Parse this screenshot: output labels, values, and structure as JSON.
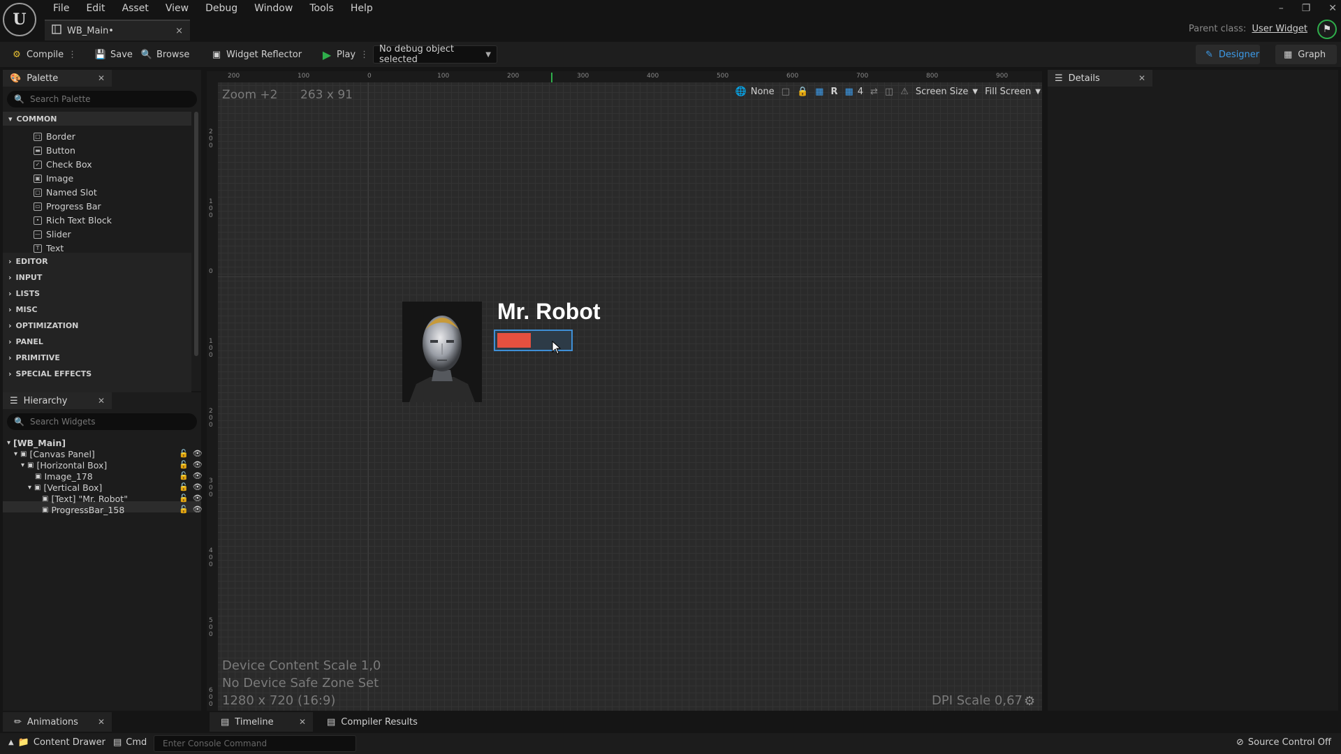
{
  "app": {
    "logo": "U"
  },
  "menu": [
    "File",
    "Edit",
    "Asset",
    "View",
    "Debug",
    "Window",
    "Tools",
    "Help"
  ],
  "doc_tab": {
    "label": "WB_Main•",
    "close": "×"
  },
  "window_controls": [
    "–",
    "❐",
    "✕"
  ],
  "parent_class": {
    "label": "Parent class:",
    "value": "User Widget"
  },
  "toolbar": {
    "compile": "Compile",
    "save": "Save",
    "browse": "Browse",
    "widget_reflector": "Widget Reflector",
    "play": "Play",
    "debug_object": "No debug object selected",
    "designer": "Designer",
    "graph": "Graph"
  },
  "palette": {
    "title": "Palette",
    "search_placeholder": "Search Palette",
    "common_label": "COMMON",
    "common_items": [
      "Border",
      "Button",
      "Check Box",
      "Image",
      "Named Slot",
      "Progress Bar",
      "Rich Text Block",
      "Slider",
      "Text"
    ],
    "categories": [
      "EDITOR",
      "INPUT",
      "LISTS",
      "MISC",
      "OPTIMIZATION",
      "PANEL",
      "PRIMITIVE",
      "SPECIAL EFFECTS"
    ]
  },
  "hierarchy": {
    "title": "Hierarchy",
    "search_placeholder": "Search Widgets",
    "items": [
      "[WB_Main]",
      "[Canvas Panel]",
      "[Horizontal Box]",
      "Image_178",
      "[Vertical Box]",
      "[Text] \"Mr. Robot\"",
      "ProgressBar_158"
    ]
  },
  "details": {
    "title": "Details"
  },
  "canvas": {
    "zoom": "Zoom +2",
    "size": "263 x 91",
    "ruler_top": [
      "200",
      "100",
      "0",
      "100",
      "200",
      "300",
      "400",
      "500",
      "600",
      "700",
      "800",
      "900"
    ],
    "ruler_left": [
      "2\n0\n0",
      "1\n0\n0",
      "0",
      "1\n0\n0",
      "2\n0\n0",
      "3\n0\n0",
      "4\n0\n0",
      "5\n0\n0",
      "6\n0\n0"
    ],
    "tools": {
      "none": "None",
      "r": "R",
      "grid": "4",
      "screen_size": "Screen Size",
      "fill_screen": "Fill Screen"
    },
    "device_scale": "Device Content Scale 1,0",
    "safe_zone": "No Device Safe Zone Set",
    "resolution": "1280 x 720 (16:9)",
    "dpi": "DPI Scale 0,67"
  },
  "preview": {
    "name": "Mr. Robot",
    "progress": 0.47
  },
  "bottom": {
    "animations": "Animations",
    "timeline": "Timeline",
    "compiler_results": "Compiler Results",
    "content_drawer": "Content Drawer",
    "cmd": "Cmd",
    "console_placeholder": "Enter Console Command",
    "source_control": "Source Control Off"
  },
  "colors": {
    "accent": "#3d9be9",
    "progress_fill": "#e5503f",
    "play_green": "#2fae4b"
  }
}
